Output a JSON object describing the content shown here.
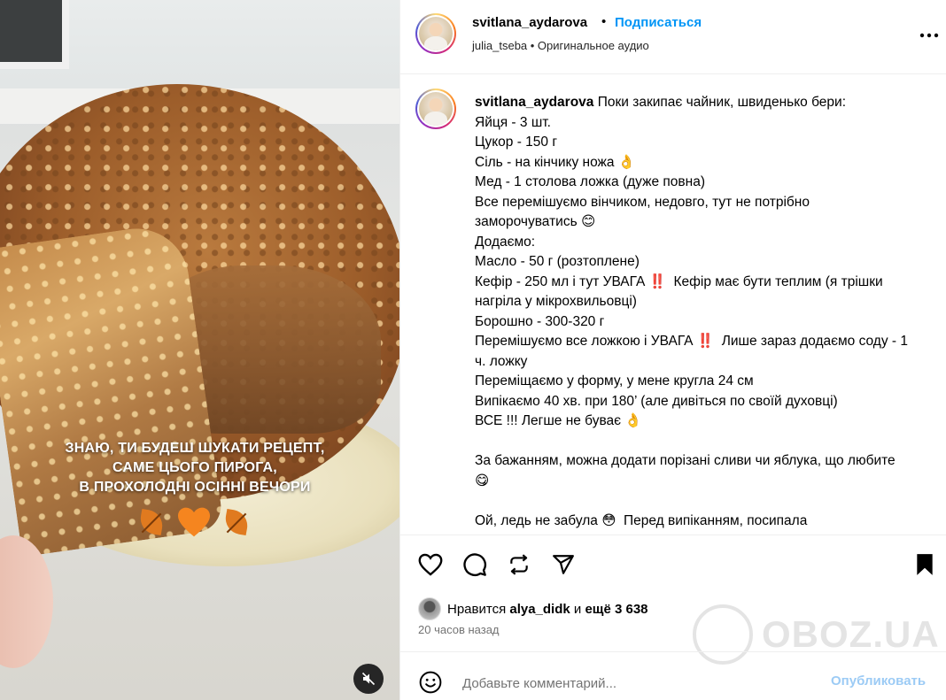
{
  "media": {
    "overlay_lines": [
      "ЗНАЮ, ТИ БУДЕШ ШУКАТИ РЕЦЕПТ,",
      "САМЕ ЦЬОГО ПИРОГА,",
      "В ПРОХОЛОДНІ ОСІННІ ВЕЧОРИ"
    ],
    "overlay_emojis": [
      "fallen-leaf",
      "orange-heart",
      "fallen-leaf"
    ],
    "mute_icon": "speaker-muted-icon"
  },
  "header": {
    "username": "svitlana_aydarova",
    "separator": "•",
    "follow_label": "Подписаться",
    "audio_line": "julia_tseba • Оригинальное аудио",
    "more_icon": "more-horizontal-icon"
  },
  "caption": {
    "username": "svitlana_aydarova",
    "text": " Поки закипає чайник, швиденько бери:\nЯйця - 3 шт.\nЦукор - 150 г\nСіль - на кінчику ножа 👌\nМед - 1 столова ложка (дуже повна)\nВсе перемішуємо вінчиком, недовго, тут не потрібно заморочуватись 😊\nДодаємо:\nМасло - 50 г (розтоплене)\nКефір - 250 мл і тут УВАГА ‼️  Кефір має бути теплим (я трішки нагріла у мікрохвильовці)\nБорошно - 300-320 г\nПеремішуємо все ложкою і УВАГА ‼️  Лише зараз додаємо соду - 1 ч. ложку\nПереміщаємо у форму, у мене кругла 24 см\nВипікаємо 40 хв. при 180’ (але дивіться по своїй духовці)\nВСЕ !!! Легше не буває 👌\n\nЗа бажанням, можна додати порізані сливи чи яблука, що любите 😋\n\nОй, ледь не забула 😳  Перед випіканням, посипала"
  },
  "actions": {
    "like_icon": "heart-icon",
    "comment_icon": "comment-icon",
    "repost_icon": "repost-icon",
    "share_icon": "share-icon",
    "save_icon": "bookmark-icon"
  },
  "likes": {
    "prefix": "Нравится ",
    "user": "alya_didk",
    "middle": " и ",
    "count": "ещё 3 638"
  },
  "time_ago": "20 часов назад",
  "comment": {
    "placeholder": "Добавьте комментарий...",
    "publish_label": "Опубликовать",
    "emoji_icon": "smiley-icon"
  },
  "watermark": {
    "text": "OBOZ.UA"
  },
  "colors": {
    "link_blue": "#0095f6",
    "publish_disabled": "#9ccbf5",
    "muted_text": "#737373"
  }
}
